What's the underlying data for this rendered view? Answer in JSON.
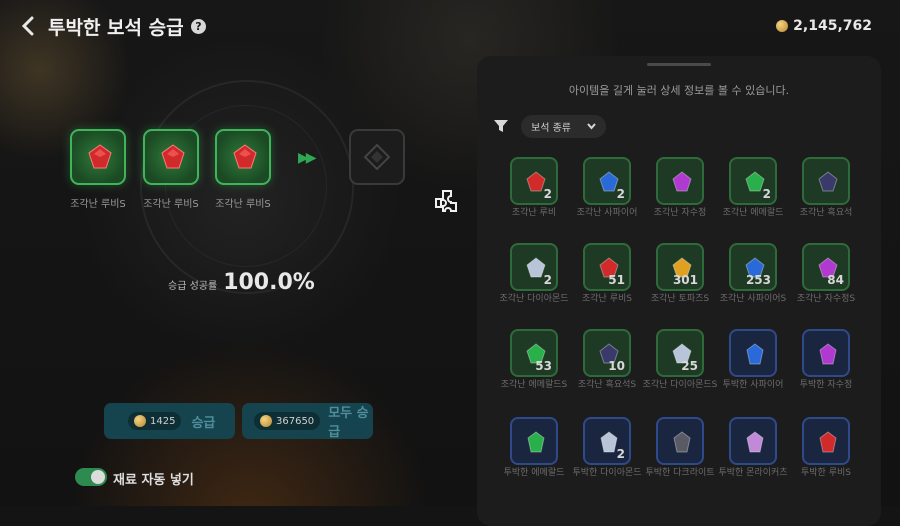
{
  "header": {
    "title": "투박한 보석 승급",
    "help_icon": "question-circle-icon",
    "currency": "2,145,762"
  },
  "upgrade": {
    "slots": [
      {
        "label": "조각난 루비S",
        "gem_color": "#d02a2a"
      },
      {
        "label": "조각난 루비S",
        "gem_color": "#d02a2a"
      },
      {
        "label": "조각난 루비S",
        "gem_color": "#d02a2a"
      }
    ],
    "success_rate_label": "승급 성공률",
    "success_rate_value": "100.0%"
  },
  "buttons": {
    "upgrade": {
      "cost": "1425",
      "label": "승급"
    },
    "upgrade_all": {
      "cost": "367650",
      "label": "모두 승급"
    }
  },
  "auto_fill": {
    "label": "재료 자동 넣기",
    "on": true
  },
  "inventory": {
    "hint": "아이템을 길게 눌러 상세 정보를 볼 수 있습니다.",
    "filter_label": "보석 종류",
    "items": [
      {
        "name": "조각난 루비",
        "count": "2",
        "color": "#d02a2a",
        "frame": "green"
      },
      {
        "name": "조각난 사파이어",
        "count": "2",
        "color": "#2a6ad8",
        "frame": "green"
      },
      {
        "name": "조각난 자수정",
        "count": "",
        "color": "#b03ad0",
        "frame": "green"
      },
      {
        "name": "조각난 에메랄드",
        "count": "2",
        "color": "#2ab04a",
        "frame": "green"
      },
      {
        "name": "조각난 흑요석",
        "count": "",
        "color": "#3a3a6a",
        "frame": "green"
      },
      {
        "name": "조각난 다이아몬드",
        "count": "2",
        "color": "#b8c4d8",
        "frame": "green"
      },
      {
        "name": "조각난 루비S",
        "count": "51",
        "color": "#d02a2a",
        "frame": "green"
      },
      {
        "name": "조각난 토파즈S",
        "count": "301",
        "color": "#e0a020",
        "frame": "green"
      },
      {
        "name": "조각난 사파이어S",
        "count": "253",
        "color": "#2a6ad8",
        "frame": "green"
      },
      {
        "name": "조각난 자수정S",
        "count": "84",
        "color": "#b03ad0",
        "frame": "green"
      },
      {
        "name": "조각난 에메랄드S",
        "count": "53",
        "color": "#2ab04a",
        "frame": "green"
      },
      {
        "name": "조각난 흑요석S",
        "count": "10",
        "color": "#3a3a6a",
        "frame": "green"
      },
      {
        "name": "조각난 다이아몬드S",
        "count": "25",
        "color": "#b8c4d8",
        "frame": "green"
      },
      {
        "name": "투박한 사파이어",
        "count": "",
        "color": "#2a6ad8",
        "frame": "blue"
      },
      {
        "name": "투박한 자수정",
        "count": "",
        "color": "#b03ad0",
        "frame": "blue"
      },
      {
        "name": "투박한 에메랄드",
        "count": "",
        "color": "#2ab04a",
        "frame": "blue"
      },
      {
        "name": "투박한 다이아몬드",
        "count": "2",
        "color": "#b8c4d8",
        "frame": "blue"
      },
      {
        "name": "투박한 다크라이트",
        "count": "",
        "color": "#5a5a66",
        "frame": "blue"
      },
      {
        "name": "투박한 몬라이커츠",
        "count": "",
        "color": "#c08ad8",
        "frame": "blue"
      },
      {
        "name": "투박한 루비S",
        "count": "",
        "color": "#d02a2a",
        "frame": "blue"
      }
    ]
  }
}
